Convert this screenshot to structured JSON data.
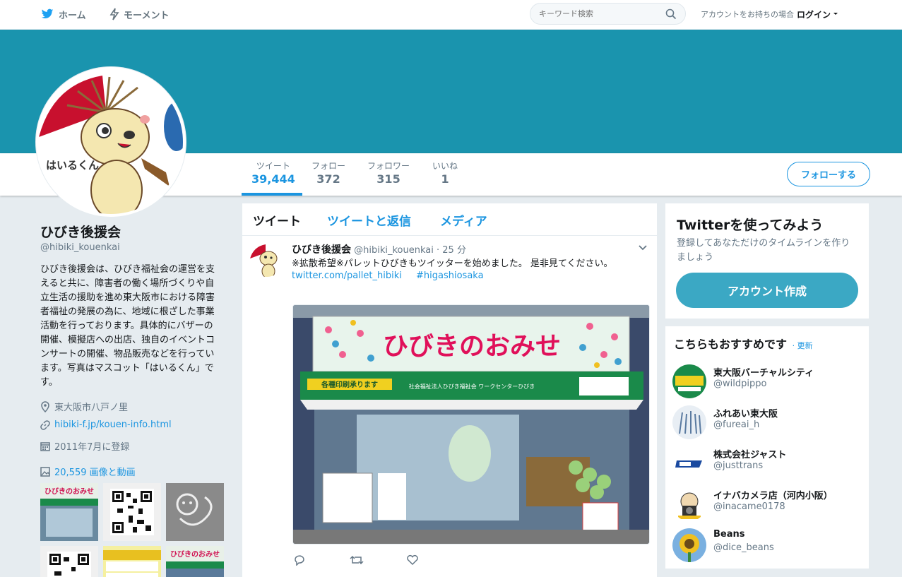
{
  "nav": {
    "home": "ホーム",
    "moments": "モーメント",
    "search_placeholder": "キーワード検索",
    "have_account": "アカウントをお持ちの場合",
    "login": "ログイン"
  },
  "profile": {
    "name": "ひびき後援会",
    "screen_name": "@hibiki_kouenkai",
    "bio": "ひびき後援会は、ひびき福祉会の運営を支えると共に、障害者の働く場所づくりや自立生活の援助を進め東大阪市における障害者福祉の発展の為に、地域に根ざした事業活動を行っております。具体的にバザーの開催、模擬店への出店、独自のイベントコンサートの開催、物品販売などを行っています。写真はマスコット「はいるくん」です。",
    "location": "東大阪市八戸ノ里",
    "url": "hibiki-f.jp/kouen-info.html",
    "joined": "2011年7月に登録",
    "media_count": "20,559 画像と動画",
    "mascot_label": "はいるくん"
  },
  "stats": [
    {
      "label": "ツイート",
      "value": "39,444"
    },
    {
      "label": "フォロー",
      "value": "372"
    },
    {
      "label": "フォロワー",
      "value": "315"
    },
    {
      "label": "いいね",
      "value": "1"
    }
  ],
  "follow_button": "フォローする",
  "timeline": {
    "tabs": [
      "ツイート",
      "ツイートと返信",
      "メディア"
    ],
    "tweet": {
      "name": "ひびき後援会",
      "handle": "@hibiki_kouenkai",
      "time": "· 25 分",
      "text": "※拡散希望※パレットひびきもツイッターを始めました。 是非見てください。",
      "link": "twitter.com/pallet_hibiki",
      "hashtag": "#higashiosaka",
      "photo_sign": "ひびきのおみせ",
      "photo_awning": "各種印刷承ります",
      "photo_org": "社会福祉法人ひびき福祉会 ワークセンターひびき"
    }
  },
  "signup": {
    "title": "Twitterを使ってみよう",
    "desc": "登録してあなただけのタイムラインを作りましょう",
    "button": "アカウント作成"
  },
  "who_to_follow": {
    "title": "こちらもおすすめです",
    "refresh": "· 更新",
    "items": [
      {
        "name": "東大阪バーチャルシティ",
        "handle": "@wildpippo"
      },
      {
        "name": "ふれあい東大阪",
        "handle": "@fureai_h"
      },
      {
        "name": "株式会社ジャスト",
        "handle": "@justtrans"
      },
      {
        "name": "イナバカメラ店（河内小阪）",
        "handle": "@inacame0178"
      },
      {
        "name": "Beans",
        "handle": "@dice_beans"
      }
    ]
  },
  "colors": {
    "banner": "#1a94ae",
    "accent": "#1b95e0",
    "signup_button": "#3ba8c4"
  }
}
